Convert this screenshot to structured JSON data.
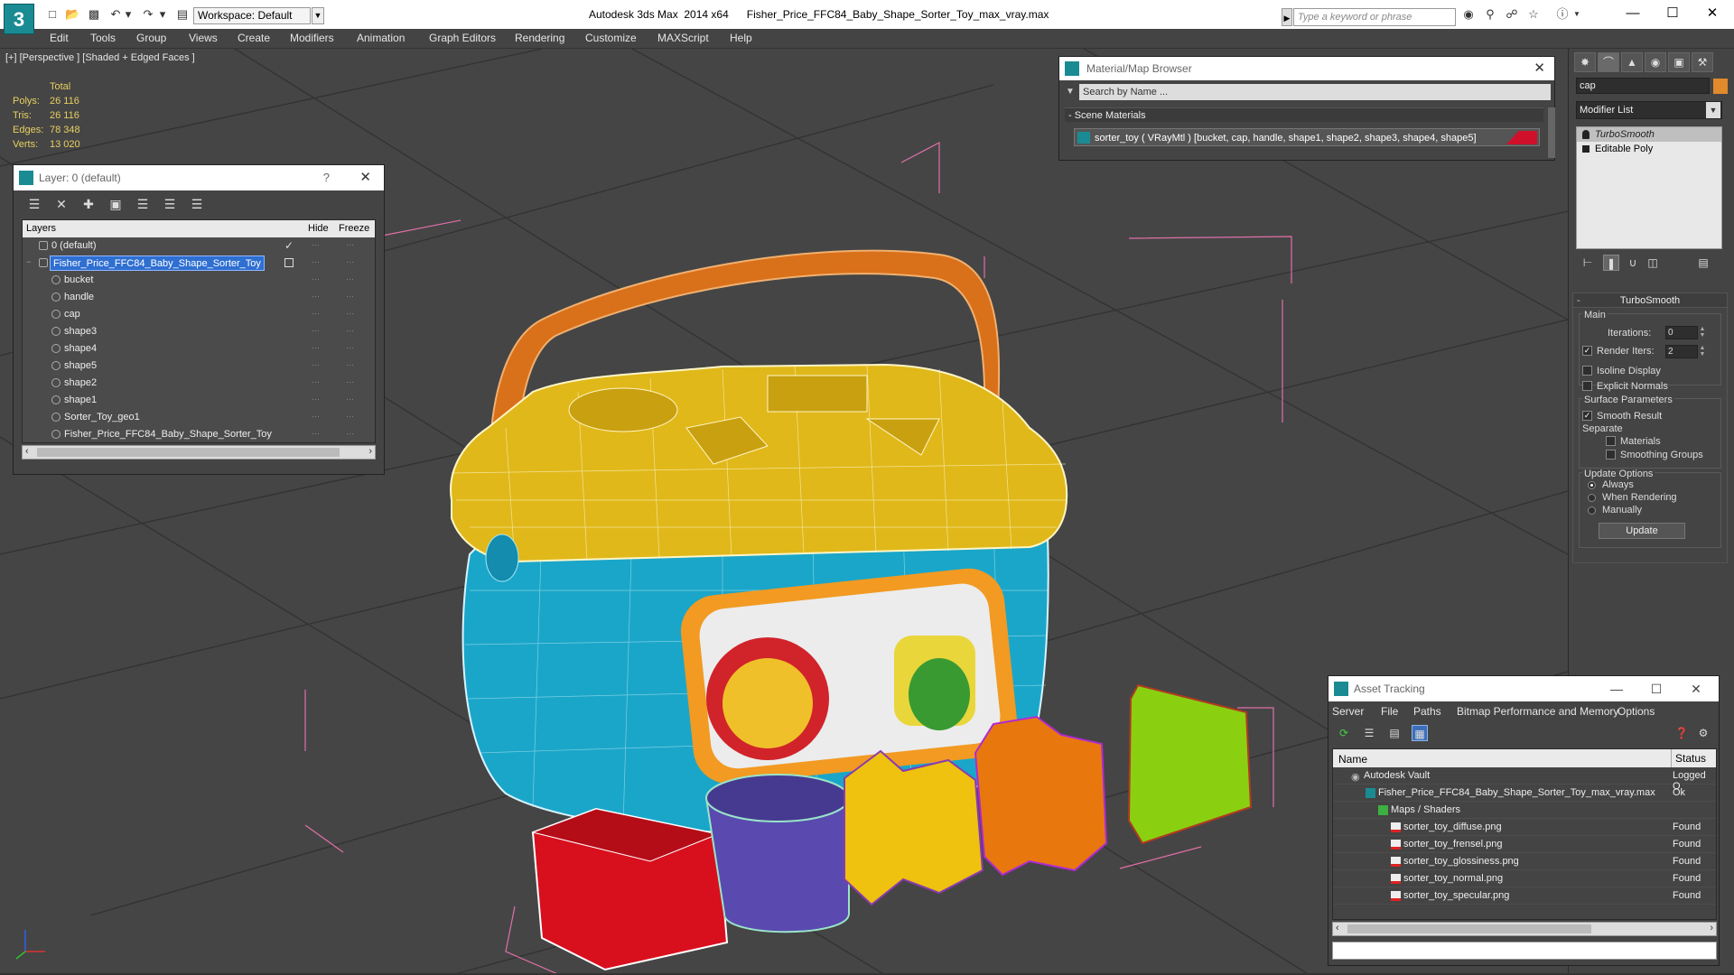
{
  "titlebar": {
    "workspace": "Workspace: Default",
    "title": "Autodesk 3ds Max  2014 x64      Fisher_Price_FFC84_Baby_Shape_Sorter_Toy_max_vray.max",
    "search_placeholder": "Type a keyword or phrase"
  },
  "menu": [
    "Edit",
    "Tools",
    "Group",
    "Views",
    "Create",
    "Modifiers",
    "Animation",
    "Graph Editors",
    "Rendering",
    "Customize",
    "MAXScript",
    "Help"
  ],
  "viewport": {
    "label": "[+] [Perspective ] [Shaded + Edged Faces ]",
    "stats": {
      "header": "Total",
      "polys_label": "Polys:",
      "polys": "26 116",
      "tris_label": "Tris:",
      "tris": "26 116",
      "edges_label": "Edges:",
      "edges": "78 348",
      "verts_label": "Verts:",
      "verts": "13 020"
    }
  },
  "layer_dialog": {
    "title": "Layer: 0 (default)",
    "help": "?",
    "col_layers": "Layers",
    "col_hide": "Hide",
    "col_freeze": "Freeze",
    "rows": [
      {
        "name": "0 (default)"
      },
      {
        "name": "Fisher_Price_FFC84_Baby_Shape_Sorter_Toy"
      },
      {
        "name": "bucket"
      },
      {
        "name": "handle"
      },
      {
        "name": "cap"
      },
      {
        "name": "shape3"
      },
      {
        "name": "shape4"
      },
      {
        "name": "shape5"
      },
      {
        "name": "shape2"
      },
      {
        "name": "shape1"
      },
      {
        "name": "Sorter_Toy_geo1"
      },
      {
        "name": "Fisher_Price_FFC84_Baby_Shape_Sorter_Toy"
      }
    ]
  },
  "material_browser": {
    "title": "Material/Map Browser",
    "search_placeholder": "Search by Name ...",
    "section": "- Scene Materials",
    "item": "sorter_toy  ( VRayMtl )  [bucket, cap, handle, shape1, shape2, shape3, shape4, shape5]"
  },
  "command_panel": {
    "object_name": "cap",
    "modifier_list": "Modifier List",
    "stack": [
      "TurboSmooth",
      "Editable Poly"
    ],
    "rollout_title": "TurboSmooth",
    "main_label": "Main",
    "iterations_label": "Iterations:",
    "iterations": "0",
    "render_iters_label": "Render Iters:",
    "render_iters": "2",
    "isoline": "Isoline Display",
    "explicit_normals": "Explicit Normals",
    "surface_params": "Surface Parameters",
    "smooth_result": "Smooth Result",
    "separate": "Separate",
    "materials": "Materials",
    "smoothing_groups": "Smoothing Groups",
    "update_options": "Update Options",
    "always": "Always",
    "when_rendering": "When Rendering",
    "manually": "Manually",
    "update_button": "Update"
  },
  "asset_tracking": {
    "title": "Asset Tracking",
    "menu": [
      "Server",
      "File",
      "Paths",
      "Bitmap Performance and Memory",
      "Options"
    ],
    "col_name": "Name",
    "col_status": "Status",
    "rows": [
      {
        "name": "Autodesk Vault",
        "status": "Logged O"
      },
      {
        "name": "Fisher_Price_FFC84_Baby_Shape_Sorter_Toy_max_vray.max",
        "status": "Ok"
      },
      {
        "name": "Maps / Shaders",
        "status": ""
      },
      {
        "name": "sorter_toy_diffuse.png",
        "status": "Found"
      },
      {
        "name": "sorter_toy_frensel.png",
        "status": "Found"
      },
      {
        "name": "sorter_toy_glossiness.png",
        "status": "Found"
      },
      {
        "name": "sorter_toy_normal.png",
        "status": "Found"
      },
      {
        "name": "sorter_toy_specular.png",
        "status": "Found"
      }
    ]
  }
}
